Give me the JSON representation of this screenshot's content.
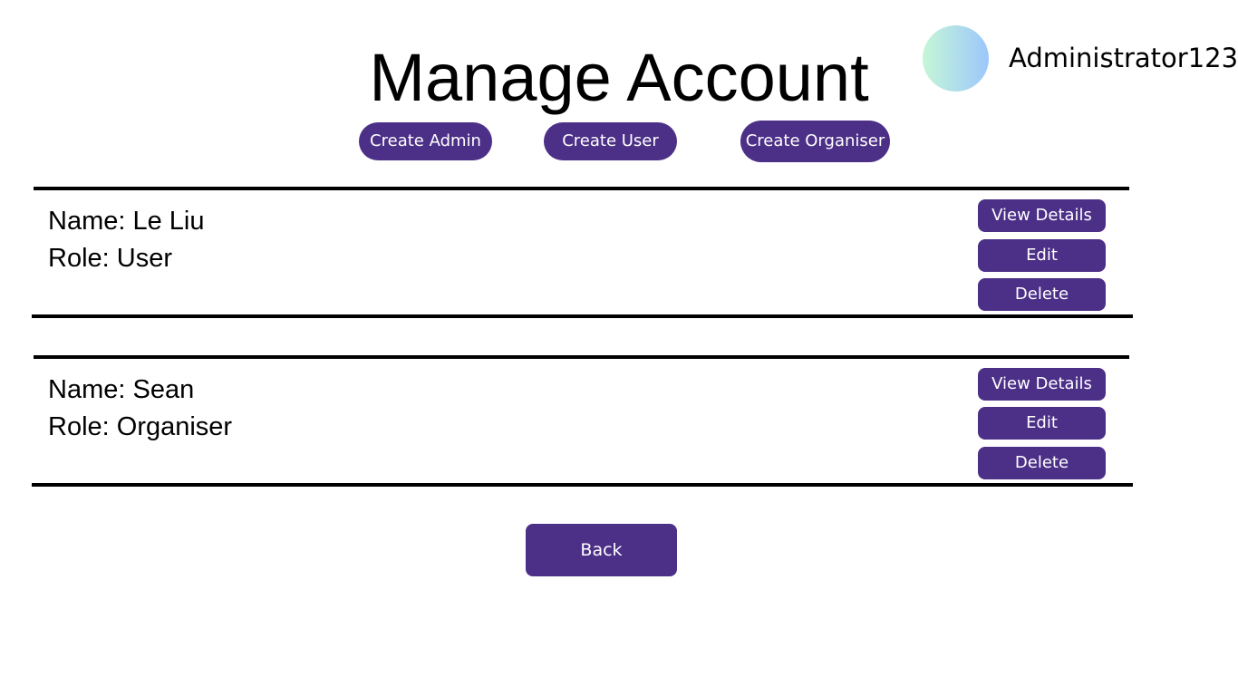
{
  "header": {
    "title": "Manage Account",
    "username": "Administrator123"
  },
  "actions": {
    "create_admin": "Create Admin",
    "create_user": "Create User",
    "create_organiser": "Create Organiser"
  },
  "accounts": [
    {
      "name_text": "Name: Le Liu",
      "role_text": "Role: User",
      "view_label": "View Details",
      "edit_label": "Edit",
      "delete_label": "Delete"
    },
    {
      "name_text": "Name: Sean",
      "role_text": "Role: Organiser",
      "view_label": "View Details",
      "edit_label": "Edit",
      "delete_label": "Delete"
    }
  ],
  "footer": {
    "back_label": "Back"
  },
  "colors": {
    "button_bg": "#4c2f87",
    "button_text": "#ffffff",
    "avatar_gradient_start": "#c6f6d7",
    "avatar_gradient_end": "#9cc7fb"
  },
  "icons": {
    "avatar": "user-avatar-circle"
  }
}
